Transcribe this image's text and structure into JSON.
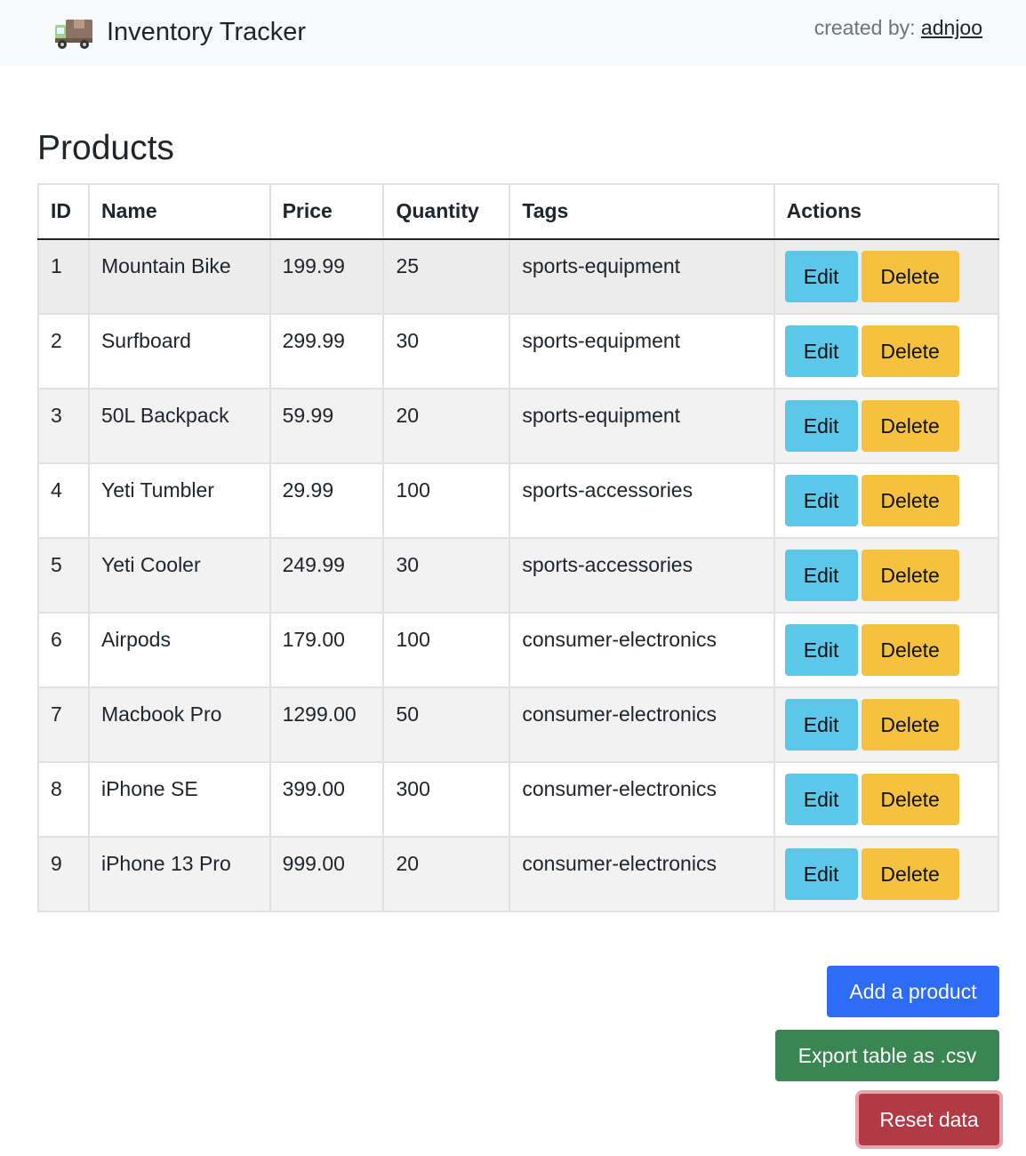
{
  "navbar": {
    "brand_icon": "delivery-truck-emoji",
    "title": "Inventory Tracker",
    "created_by_label": "created by:",
    "author": "adnjoo"
  },
  "page": {
    "heading": "Products"
  },
  "table": {
    "headers": [
      "ID",
      "Name",
      "Price",
      "Quantity",
      "Tags",
      "Actions"
    ],
    "rows": [
      {
        "id": "1",
        "name": "Mountain Bike",
        "price": "199.99",
        "quantity": "25",
        "tags": "sports-equipment"
      },
      {
        "id": "2",
        "name": "Surfboard",
        "price": "299.99",
        "quantity": "30",
        "tags": "sports-equipment"
      },
      {
        "id": "3",
        "name": "50L Backpack",
        "price": "59.99",
        "quantity": "20",
        "tags": "sports-equipment"
      },
      {
        "id": "4",
        "name": "Yeti Tumbler",
        "price": "29.99",
        "quantity": "100",
        "tags": "sports-accessories"
      },
      {
        "id": "5",
        "name": "Yeti Cooler",
        "price": "249.99",
        "quantity": "30",
        "tags": "sports-accessories"
      },
      {
        "id": "6",
        "name": "Airpods",
        "price": "179.00",
        "quantity": "100",
        "tags": "consumer-electronics"
      },
      {
        "id": "7",
        "name": "Macbook Pro",
        "price": "1299.00",
        "quantity": "50",
        "tags": "consumer-electronics"
      },
      {
        "id": "8",
        "name": "iPhone SE",
        "price": "399.00",
        "quantity": "300",
        "tags": "consumer-electronics"
      },
      {
        "id": "9",
        "name": "iPhone 13 Pro",
        "price": "999.00",
        "quantity": "20",
        "tags": "consumer-electronics"
      }
    ],
    "edit_label": "Edit",
    "delete_label": "Delete"
  },
  "actions": {
    "add_label": "Add a product",
    "export_label": "Export table as .csv",
    "reset_label": "Reset data"
  },
  "colors": {
    "edit": "#5bc8e9",
    "delete": "#f6c23e",
    "add": "#2d6cf5",
    "export": "#3a8653",
    "reset": "#b13a45"
  }
}
